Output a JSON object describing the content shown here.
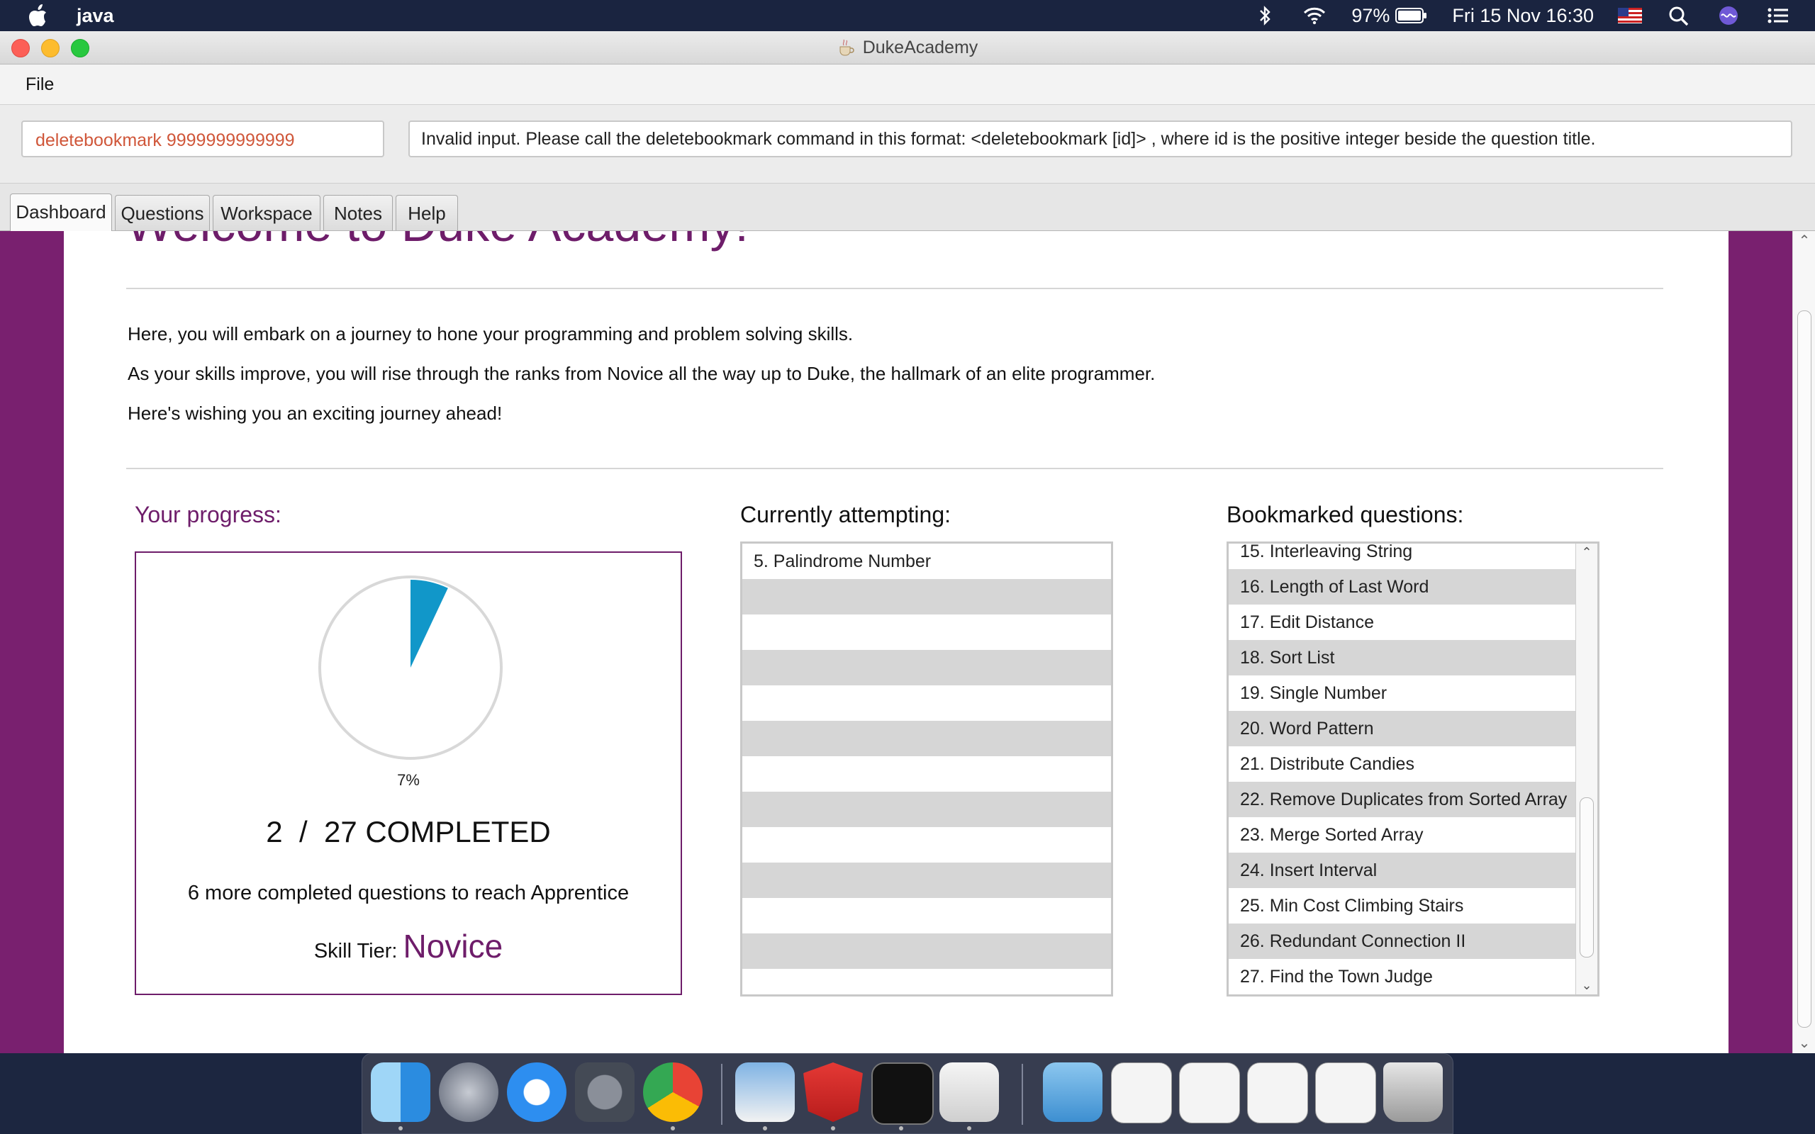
{
  "menubar": {
    "app_name": "java",
    "battery": "97%",
    "datetime": "Fri 15 Nov  16:30"
  },
  "window": {
    "title": "DukeAcademy"
  },
  "menu": {
    "file": "File"
  },
  "command": {
    "input_value": "deletebookmark 9999999999999",
    "result_message": "Invalid input. Please call the deletebookmark command in this format: <deletebookmark [id]> , where id is the positive integer beside the question title."
  },
  "tabs": [
    {
      "label": "Dashboard",
      "active": true
    },
    {
      "label": "Questions",
      "active": false
    },
    {
      "label": "Workspace",
      "active": false
    },
    {
      "label": "Notes",
      "active": false
    },
    {
      "label": "Help",
      "active": false
    }
  ],
  "dashboard": {
    "welcome": "Welcome to Duke Academy!",
    "intro": [
      "Here, you will embark on a journey to hone your programming and problem solving skills.",
      "As your skills improve, you will rise through the ranks from Novice all the way up to Duke, the hallmark of an elite programmer.",
      "Here's wishing you an exciting journey ahead!"
    ],
    "progress": {
      "heading": "Your progress:",
      "percent_label": "7%",
      "percent_value": 0.07,
      "completed": "2",
      "separator": "/",
      "total": "27 COMPLETED",
      "to_reach": "6 more completed questions to reach Apprentice",
      "tier_label": "Skill Tier:",
      "tier_value": "Novice"
    },
    "attempting": {
      "heading": "Currently attempting:",
      "items": [
        "5. Palindrome Number"
      ]
    },
    "bookmarked": {
      "heading": "Bookmarked questions:",
      "items": [
        "15. Interleaving String",
        "16. Length of Last Word",
        "17. Edit Distance",
        "18. Sort List",
        "19. Single Number",
        "20. Word Pattern",
        "21. Distribute Candies",
        "22. Remove Duplicates from Sorted Array",
        "23. Merge Sorted Array",
        "24. Insert Interval",
        "25. Min Cost Climbing Stairs",
        "26. Redundant Connection II",
        "27. Find the Town Judge"
      ]
    }
  },
  "colors": {
    "accent_purple": "#6e1d6a",
    "sidebar_purple": "#79206f",
    "pie_fill": "#1197c9",
    "error_text": "#d0573a"
  },
  "dock": {
    "icons": [
      "finder-icon",
      "launchpad-icon",
      "safari-icon",
      "system-preferences-icon",
      "chrome-icon",
      "preview-icon",
      "angular-icon",
      "terminal-icon",
      "java-cup-icon",
      "downloads-folder-icon",
      "window-thumbnail-icon",
      "window-thumbnail-icon",
      "window-thumbnail-icon",
      "window-thumbnail-icon",
      "trash-icon"
    ]
  }
}
